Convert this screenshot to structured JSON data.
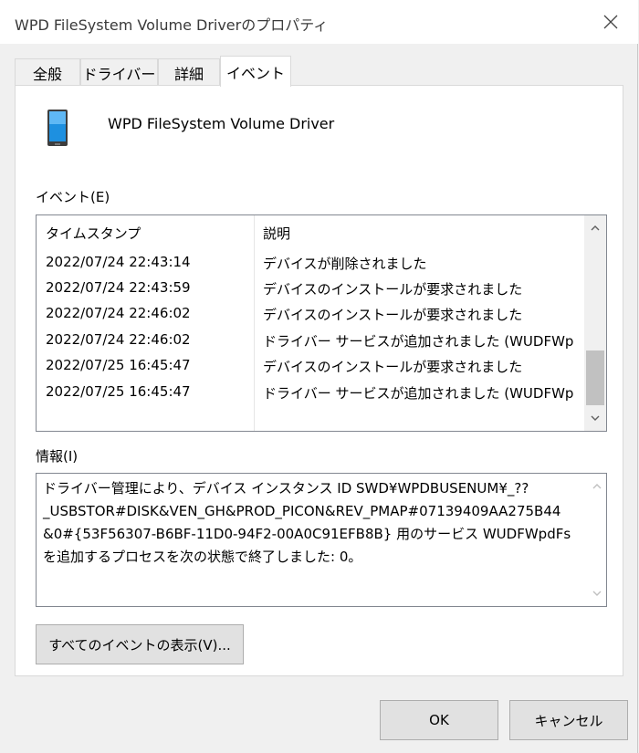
{
  "window": {
    "title": "WPD FileSystem Volume Driverのプロパティ",
    "close_icon": "close-icon"
  },
  "tabs": [
    {
      "label": "全般",
      "active": false
    },
    {
      "label": "ドライバー",
      "active": false
    },
    {
      "label": "詳細",
      "active": false
    },
    {
      "label": "イベント",
      "active": true
    }
  ],
  "device": {
    "icon": "portable-device-icon",
    "name": "WPD FileSystem Volume Driver"
  },
  "events": {
    "label": "イベント(E)",
    "columns": [
      "タイムスタンプ",
      "説明"
    ],
    "rows": [
      {
        "timestamp": "2022/07/24 22:43:14",
        "description": "デバイスが削除されました"
      },
      {
        "timestamp": "2022/07/24 22:43:59",
        "description": "デバイスのインストールが要求されました"
      },
      {
        "timestamp": "2022/07/24 22:46:02",
        "description": "デバイスのインストールが要求されました"
      },
      {
        "timestamp": "2022/07/24 22:46:02",
        "description": "ドライバー サービスが追加されました (WUDFWp..."
      },
      {
        "timestamp": "2022/07/25 16:45:47",
        "description": "デバイスのインストールが要求されました"
      },
      {
        "timestamp": "2022/07/25 16:45:47",
        "description": "ドライバー サービスが追加されました (WUDFWp..."
      }
    ]
  },
  "info": {
    "label": "情報(I)",
    "lines": [
      "ドライバー管理により、デバイス インスタンス ID SWD¥WPDBUSENUM¥_??",
      "_USBSTOR#DISK&VEN_GH&PROD_PICON&REV_PMAP#07139409AA275B44",
      "&0#{53F56307-B6BF-11D0-94F2-00A0C91EFB8B} 用のサービス WUDFWpdFs",
      "を追加するプロセスを次の状態で終了しました: 0。"
    ]
  },
  "buttons": {
    "show_all": "すべてのイベントの表示(V)...",
    "ok": "OK",
    "cancel": "キャンセル"
  }
}
